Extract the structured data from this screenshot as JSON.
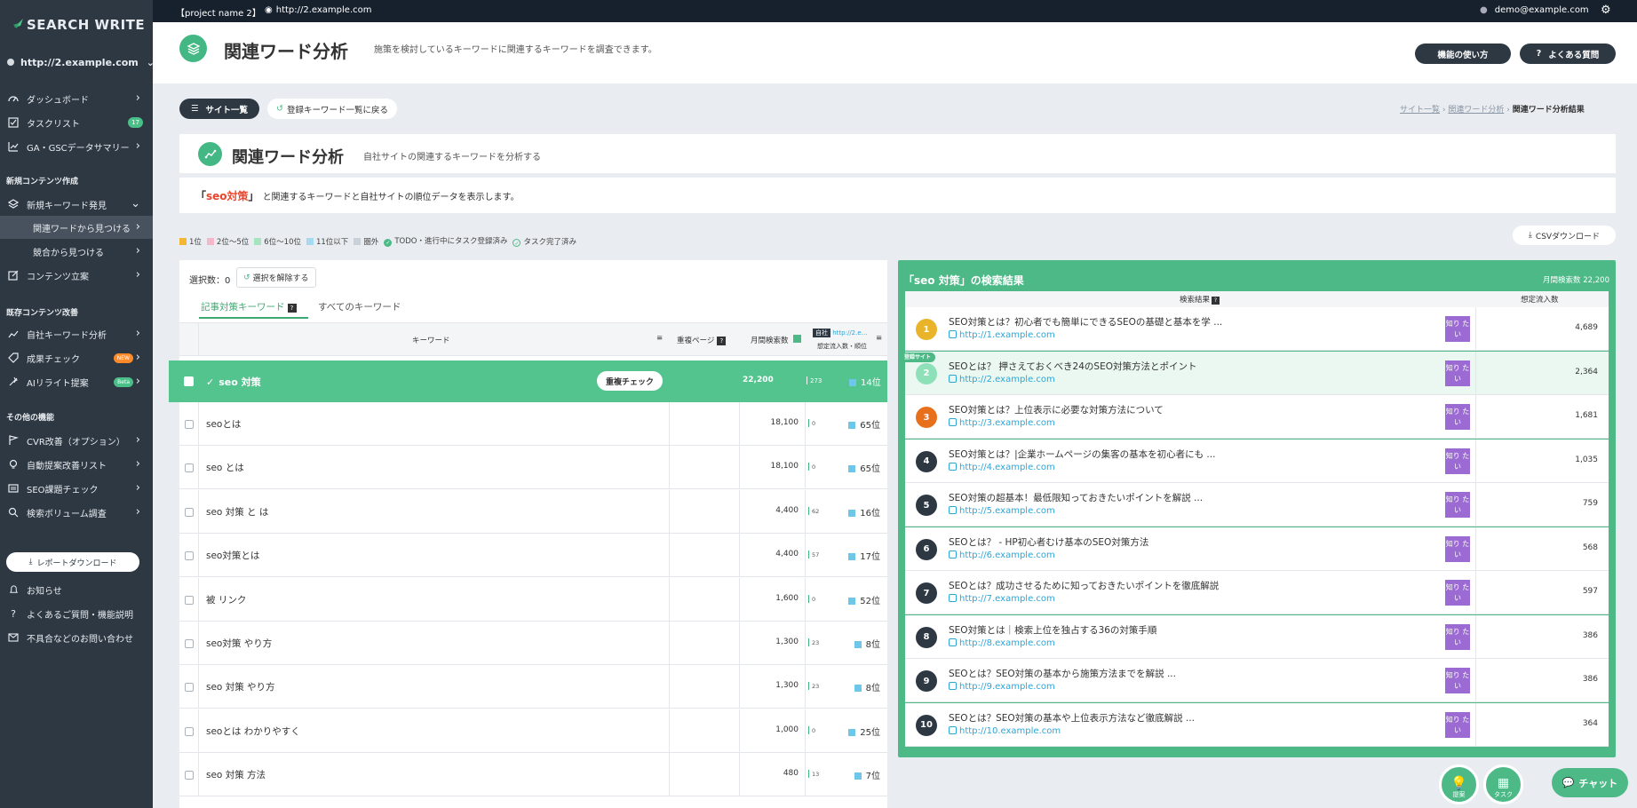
{
  "sidebar": {
    "logo": "SEARCH WRITE",
    "site": "http://2.example.com",
    "tasklist_count": "17",
    "items": {
      "dashboard": "ダッシュボード",
      "tasklist": "タスクリスト",
      "ga": "GA・GSCデータサマリー"
    },
    "section_new": "新規コンテンツ作成",
    "new_kw": "新規キーワード発見",
    "related": "関連ワードから見つける",
    "competitor": "競合から見つける",
    "content_plan": "コンテンツ立案",
    "section_existing": "既存コンテンツ改善",
    "own_kw": "自社キーワード分析",
    "result_check": "成果チェック",
    "new_badge": "NEW",
    "ai_rewrite": "AIリライト提案",
    "beta_badge": "Beta",
    "section_other": "その他の機能",
    "cvr": "CVR改善（オプション）",
    "auto_list": "自動提案改善リスト",
    "seo_check": "SEO課題チェック",
    "volume": "検索ボリューム調査",
    "report_btn": "レポートダウンロード",
    "notice": "お知らせ",
    "faq": "よくあるご質問・機能説明",
    "contact": "不具合などのお問い合わせ"
  },
  "topbar": {
    "project": "【project name 2】",
    "url": "http://2.example.com",
    "user": "demo@example.com"
  },
  "header": {
    "title": "関連ワード分析",
    "subtitle": "施策を検討しているキーワードに関連するキーワードを調査できます。",
    "howto_btn": "機能の使い方",
    "faq_btn": "よくある質問"
  },
  "toolbar": {
    "site_list_btn": "サイト一覧",
    "back_btn": "登録キーワード一覧に戻る"
  },
  "breadcrumb": {
    "c1": "サイト一覧",
    "c2": "関連ワード分析",
    "c3": "関連ワード分析結果"
  },
  "section": {
    "title": "関連ワード分析",
    "subtitle": "自社サイトの関連するキーワードを分析する"
  },
  "notice": {
    "pre": "「",
    "keyword": "seo対策",
    "post": "」",
    "text": "と関連するキーワードと自社サイトの順位データを表示します。"
  },
  "legend": {
    "r1": "1位",
    "r2": "2位〜5位",
    "r3": "6位〜10位",
    "r4": "11位以下",
    "r5": "圏外",
    "todo": "TODO・進行中にタスク登録済み",
    "done": "タスク完了済み",
    "colors": {
      "r1": "#f5b731",
      "r2": "#f6b8c8",
      "r3": "#a7e2c1",
      "r4": "#a8d9f2",
      "r5": "#c8d1d9"
    }
  },
  "csv_btn": "CSVダウンロード",
  "left": {
    "selected_label": "選択数：",
    "selected_count": "0",
    "clear_btn": "選択を解除する",
    "tab_active": "記事対策キーワード",
    "tab_all": "すべてのキーワード",
    "col_keyword": "キーワード",
    "col_dup": "重複ページ",
    "col_volume": "月間検索数",
    "col_own": "自社",
    "col_own_url": "http://2.e…",
    "col_flow_rank": "想定流入数・順位",
    "highlight": {
      "keyword": "seo 対策",
      "dup_btn": "重複チェック",
      "volume": "22,200",
      "flow": "273",
      "rank": "14位"
    },
    "rows": [
      {
        "keyword": "seoとは",
        "volume": "18,100",
        "flow": "0",
        "rank": "65位"
      },
      {
        "keyword": "seo とは",
        "volume": "18,100",
        "flow": "0",
        "rank": "65位"
      },
      {
        "keyword": "seo 対策 と は",
        "volume": "4,400",
        "flow": "62",
        "rank": "16位"
      },
      {
        "keyword": "seo対策とは",
        "volume": "4,400",
        "flow": "57",
        "rank": "17位"
      },
      {
        "keyword": "被 リンク",
        "volume": "1,600",
        "flow": "0",
        "rank": "52位"
      },
      {
        "keyword": "seo対策 やり方",
        "volume": "1,300",
        "flow": "23",
        "rank": "8位"
      },
      {
        "keyword": "seo 対策 やり方",
        "volume": "1,300",
        "flow": "23",
        "rank": "8位"
      },
      {
        "keyword": "seoとは わかりやすく",
        "volume": "1,000",
        "flow": "0",
        "rank": "25位"
      },
      {
        "keyword": "seo 対策 方法",
        "volume": "480",
        "flow": "13",
        "rank": "7位"
      }
    ]
  },
  "right": {
    "title": "「seo 対策」の検索結果",
    "monthly": "月間検索数 22,200",
    "col_results": "検索結果",
    "col_flow": "想定流入数",
    "own_site_label": "登録サイト",
    "tag": "知り たい",
    "results": [
      {
        "n": "1",
        "title": "SEO対策とは？初心者でも簡単にできるSEOの基礎と基本を学 ...",
        "url": "http://1.example.com",
        "flow": "4,689",
        "color": "#e9b42a"
      },
      {
        "n": "2",
        "title": "SEOとは？ 押さえておくべき24のSEO対策方法とポイント",
        "url": "http://2.example.com",
        "flow": "2,364",
        "color": "#8ee0b8"
      },
      {
        "n": "3",
        "title": "SEO対策とは？上位表示に必要な対策方法について",
        "url": "http://3.example.com",
        "flow": "1,681",
        "color": "#e8701c"
      },
      {
        "n": "4",
        "title": "SEO対策とは？|企業ホームページの集客の基本を初心者にも ...",
        "url": "http://4.example.com",
        "flow": "1,035",
        "color": "#2d3843"
      },
      {
        "n": "5",
        "title": "SEO対策の超基本！最低限知っておきたいポイントを解説 ...",
        "url": "http://5.example.com",
        "flow": "759",
        "color": "#2d3843"
      },
      {
        "n": "6",
        "title": "SEOとは？ - HP初心者むけ基本のSEO対策方法",
        "url": "http://6.example.com",
        "flow": "568",
        "color": "#2d3843"
      },
      {
        "n": "7",
        "title": "SEOとは？成功させるために知っておきたいポイントを徹底解説",
        "url": "http://7.example.com",
        "flow": "597",
        "color": "#2d3843"
      },
      {
        "n": "8",
        "title": "SEO対策とは｜検索上位を独占する36の対策手順",
        "url": "http://8.example.com",
        "flow": "386",
        "color": "#2d3843"
      },
      {
        "n": "9",
        "title": "SEOとは？SEO対策の基本から施策方法までを解説 ...",
        "url": "http://9.example.com",
        "flow": "386",
        "color": "#2d3843"
      },
      {
        "n": "10",
        "title": "SEOとは？SEO対策の基本や上位表示方法など徹底解説 ...",
        "url": "http://10.example.com",
        "flow": "364",
        "color": "#2d3843"
      }
    ]
  },
  "fabs": {
    "proposal": "提案",
    "task": "タスク",
    "chat": "チャット"
  }
}
